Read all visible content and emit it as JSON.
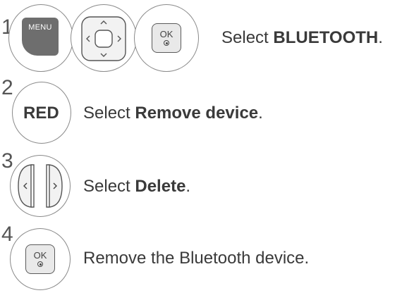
{
  "steps": [
    {
      "number": "1",
      "buttons": {
        "menu_label": "MENU",
        "ok_label": "OK"
      },
      "text_prefix": "Select ",
      "text_bold": "BLUETOOTH",
      "text_suffix": "."
    },
    {
      "number": "2",
      "button_label": "RED",
      "text_prefix": "Select ",
      "text_bold": "Remove device",
      "text_suffix": "."
    },
    {
      "number": "3",
      "text_prefix": "Select ",
      "text_bold": "Delete",
      "text_suffix": "."
    },
    {
      "number": "4",
      "buttons": {
        "ok_label": "OK"
      },
      "text_prefix": "Remove the Bluetooth device.",
      "text_bold": "",
      "text_suffix": ""
    }
  ]
}
